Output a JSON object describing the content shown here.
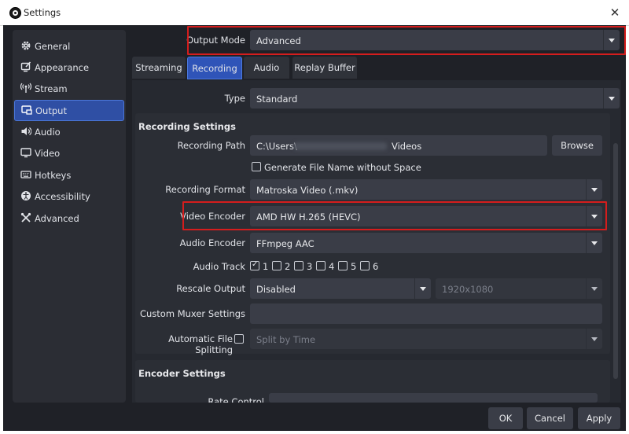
{
  "window": {
    "title": "Settings",
    "close_glyph": "✕",
    "app_icon": "obs-logo-icon"
  },
  "sidebar": {
    "items": [
      {
        "label": "General",
        "icon": "gear-icon"
      },
      {
        "label": "Appearance",
        "icon": "appearance-icon"
      },
      {
        "label": "Stream",
        "icon": "antenna-icon"
      },
      {
        "label": "Output",
        "icon": "output-icon",
        "active": true
      },
      {
        "label": "Audio",
        "icon": "speaker-icon"
      },
      {
        "label": "Video",
        "icon": "monitor-icon"
      },
      {
        "label": "Hotkeys",
        "icon": "keyboard-icon"
      },
      {
        "label": "Accessibility",
        "icon": "accessibility-icon"
      },
      {
        "label": "Advanced",
        "icon": "tools-icon"
      }
    ]
  },
  "output_mode": {
    "label": "Output Mode",
    "value": "Advanced"
  },
  "tabs": [
    {
      "label": "Streaming"
    },
    {
      "label": "Recording",
      "active": true
    },
    {
      "label": "Audio"
    },
    {
      "label": "Replay Buffer"
    }
  ],
  "recording": {
    "type": {
      "label": "Type",
      "value": "Standard"
    },
    "settings_title": "Recording Settings",
    "path": {
      "label": "Recording Path",
      "value_prefix": "C:\\Users\\",
      "value_suffix": "Videos",
      "browse": "Browse"
    },
    "no_space": {
      "label": "Generate File Name without Space",
      "checked": false
    },
    "format": {
      "label": "Recording Format",
      "value": "Matroska Video (.mkv)"
    },
    "video_encoder": {
      "label": "Video Encoder",
      "value": "AMD HW H.265 (HEVC)"
    },
    "audio_encoder": {
      "label": "Audio Encoder",
      "value": "FFmpeg AAC"
    },
    "audio_track": {
      "label": "Audio Track",
      "tracks": [
        "1",
        "2",
        "3",
        "4",
        "5",
        "6"
      ],
      "checked": [
        true,
        false,
        false,
        false,
        false,
        false
      ]
    },
    "rescale": {
      "label": "Rescale Output",
      "value": "Disabled",
      "resolution": "1920x1080"
    },
    "muxer": {
      "label": "Custom Muxer Settings",
      "value": ""
    },
    "splitting": {
      "label": "Automatic File Splitting",
      "value": "Split by Time"
    },
    "encoder_settings_title": "Encoder Settings",
    "rate_control_label": "Rate Control"
  },
  "footer": {
    "ok": "OK",
    "cancel": "Cancel",
    "apply": "Apply"
  },
  "colors": {
    "accent": "#2f54b8",
    "highlight": "#d51d1d",
    "background": "#1f2127"
  }
}
